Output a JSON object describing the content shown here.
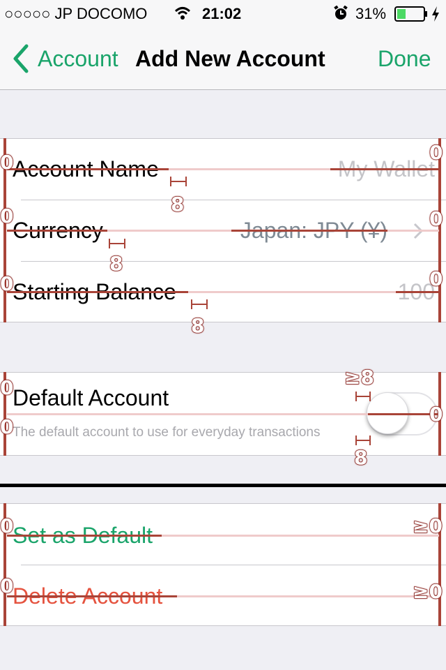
{
  "status_bar": {
    "carrier": "○○○○○ JP DOCOMO",
    "time": "21:02",
    "battery_percent": "31%",
    "battery_level": 0.31,
    "icons": [
      "wifi-icon",
      "alarm-clock-icon",
      "battery-icon",
      "charging-bolt-icon"
    ]
  },
  "nav": {
    "back_label": "Account",
    "title": "Add New Account",
    "done_label": "Done",
    "accent": "#1aa46a"
  },
  "fields": {
    "account_name_label": "Account Name",
    "account_name_placeholder": "My Wallet",
    "currency_label": "Currency",
    "currency_value": "Japan: JPY (¥)",
    "starting_balance_label": "Starting Balance",
    "starting_balance_placeholder": "100"
  },
  "default_section": {
    "label": "Default Account",
    "description": "The default account to use for everyday transactions",
    "switch_on": false
  },
  "actions": {
    "set_default_label": "Set as Default",
    "delete_label": "Delete Account",
    "set_default_color": "#1aa46a",
    "delete_color": "#e5533f"
  },
  "overlay": {
    "zero": "0",
    "eight": "8",
    "gte_eight": "≥8",
    "gte_zero": "≥0",
    "color": "#a94438"
  }
}
